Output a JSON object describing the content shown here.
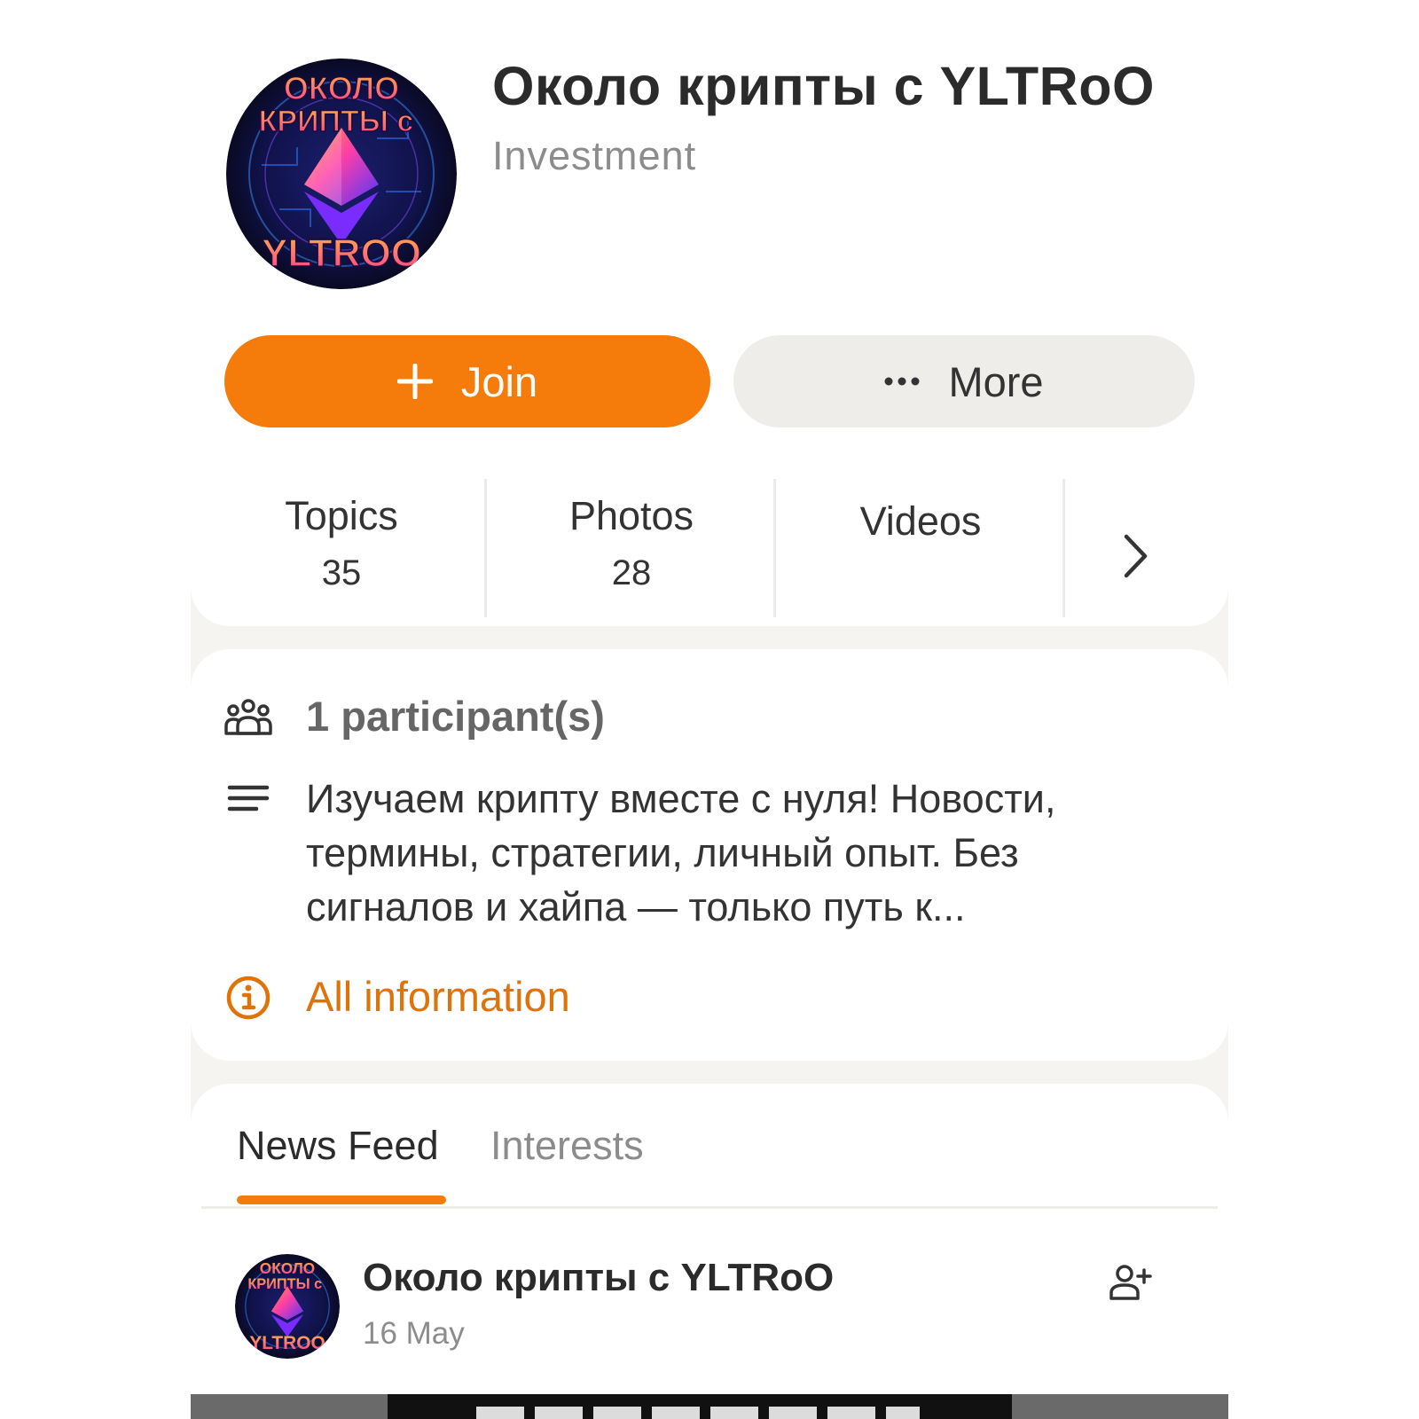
{
  "group": {
    "title": "Около крипты с YLTRoO",
    "category": "Investment",
    "avatar_label_top": "ОКОЛО",
    "avatar_label_mid": "КРИПТЫ с",
    "avatar_label_bottom": "YLTROO"
  },
  "actions": {
    "join_label": "Join",
    "more_label": "More"
  },
  "stats": [
    {
      "label": "Topics",
      "value": "35"
    },
    {
      "label": "Photos",
      "value": "28"
    },
    {
      "label": "Videos",
      "value": ""
    }
  ],
  "info": {
    "participants": "1 participant(s)",
    "description": "Изучаем крипту вместе с нуля! Новости, термины, стратегии, личный опыт. Без сигналов и хайпа — только путь к...",
    "all_info_label": "All information"
  },
  "tabs": [
    {
      "label": "News Feed",
      "active": true
    },
    {
      "label": "Interests",
      "active": false
    }
  ],
  "post": {
    "author": "Около крипты с YLTRoO",
    "date": "16 May"
  },
  "colors": {
    "accent": "#f57c0a",
    "link": "#e0720a",
    "secondary_button": "#efedea",
    "page_bg": "#f6f4f1"
  },
  "icons": [
    "plus-icon",
    "more-dots-icon",
    "chevron-right-icon",
    "participants-icon",
    "description-lines-icon",
    "info-icon",
    "add-friend-icon"
  ]
}
